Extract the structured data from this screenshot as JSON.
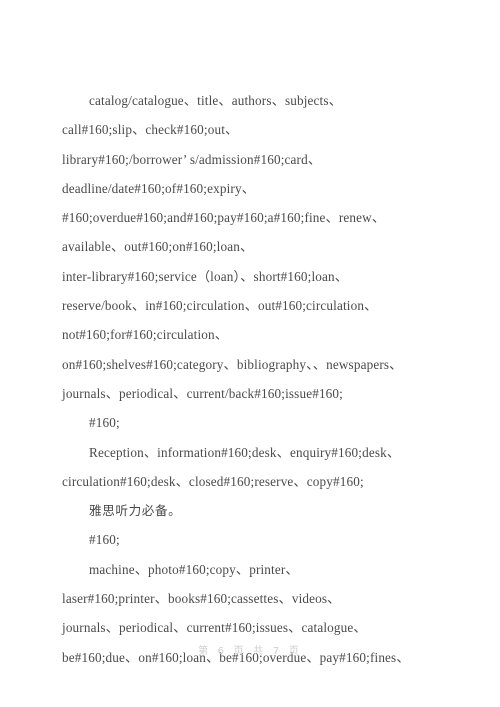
{
  "document": {
    "page_background": "#ffffff",
    "text_color": "#4a4a4a",
    "footer_color": "#cfcfcf",
    "blocks": [
      {
        "id": "block_1",
        "indent": true,
        "text": "catalog/catalogue、title、authors、subjects、\ncall#160;slip、check#160;out、\nlibrary#160;/borrower’ s/admission#160;card、\ndeadline/date#160;of#160;expiry、\n#160;overdue#160;and#160;pay#160;a#160;fine、renew、\navailable、out#160;on#160;loan、\ninter‐library#160;service（loan）、short#160;loan、\nreserve/book、in#160;circulation、out#160;circulation、\nnot#160;for#160;circulation、\non#160;shelves#160;category、bibliography、、newspapers、\njournals、periodical、current/back#160;issue#160;"
      },
      {
        "id": "block_2",
        "indent": true,
        "text": "#160;"
      },
      {
        "id": "block_3",
        "indent": true,
        "text": "Reception、information#160;desk、enquiry#160;desk、\ncirculation#160;desk、closed#160;reserve、copy#160;"
      },
      {
        "id": "block_4",
        "indent": true,
        "chinese": true,
        "text": "雅思听力必备。"
      },
      {
        "id": "block_5",
        "indent": true,
        "text": "#160;"
      },
      {
        "id": "block_6",
        "indent": true,
        "text": "machine、photo#160;copy、printer、\nlaser#160;printer、books#160;cassettes、videos、\njournals、periodical、current#160;issues、catalogue、\nbe#160;due、on#160;loan、be#160;overdue、pay#160;fines、"
      }
    ]
  },
  "footer": {
    "page_indicator": "第 6 页 共 7 页",
    "current_page": "6",
    "total_pages": "7"
  }
}
